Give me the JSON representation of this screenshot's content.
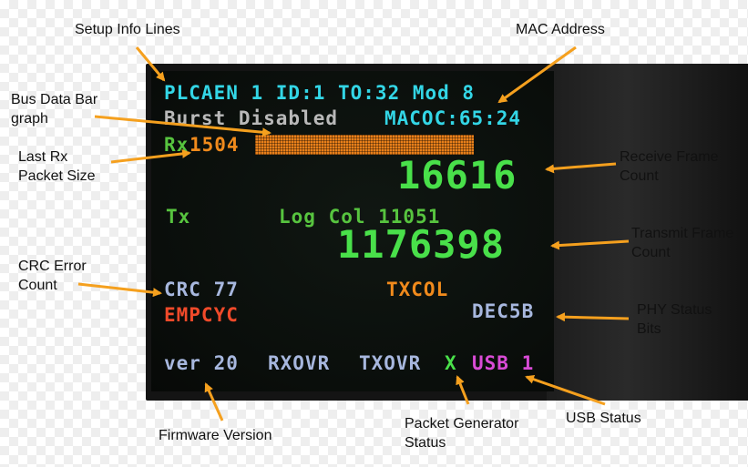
{
  "callouts": {
    "setup_info": "Setup Info Lines",
    "mac_address": "MAC Address",
    "bus_bar_line1": "Bus Data Bar",
    "bus_bar_line2": "graph",
    "last_rx_line1": "Last Rx",
    "last_rx_line2": "Packet Size",
    "rx_count_line1": "Receive Frame",
    "rx_count_line2": "Count",
    "tx_count_line1": "Transmit Frame",
    "tx_count_line2": "Count",
    "crc_line1": "CRC Error",
    "crc_line2": "Count",
    "phy_line1": "PHY Status",
    "phy_line2": "Bits",
    "firmware": "Firmware Version",
    "pktgen_line1": "Packet Generator",
    "pktgen_line2": "Status",
    "usb_status": "USB Status"
  },
  "display": {
    "line1": "PLCAEN 1 ID:1 TO:32 Mod 8",
    "burst": "Burst Disabled",
    "macoc": "MACOC:65:24",
    "rx_label": "Rx",
    "rx_size": "1504",
    "rx_count": "16616",
    "tx_label": "Tx",
    "log_col": "Log Col 11051",
    "tx_count": "1176398",
    "crc": "CRC 77",
    "txcol": "TXCOL",
    "empcyc": "EMPCYC",
    "phy_bits": "DEC5B",
    "version": "ver 20",
    "rxovr": "RXOVR",
    "txovr": "TXOVR",
    "pktgen": "X",
    "usb": "USB 1"
  },
  "colors": {
    "arrow": "#f5a01e",
    "cyan": "#33d6e6",
    "green": "#57c43f",
    "orange": "#f08a1c",
    "red": "#f04a2a",
    "purple": "#d94bd6",
    "blue": "#a7b7de"
  }
}
